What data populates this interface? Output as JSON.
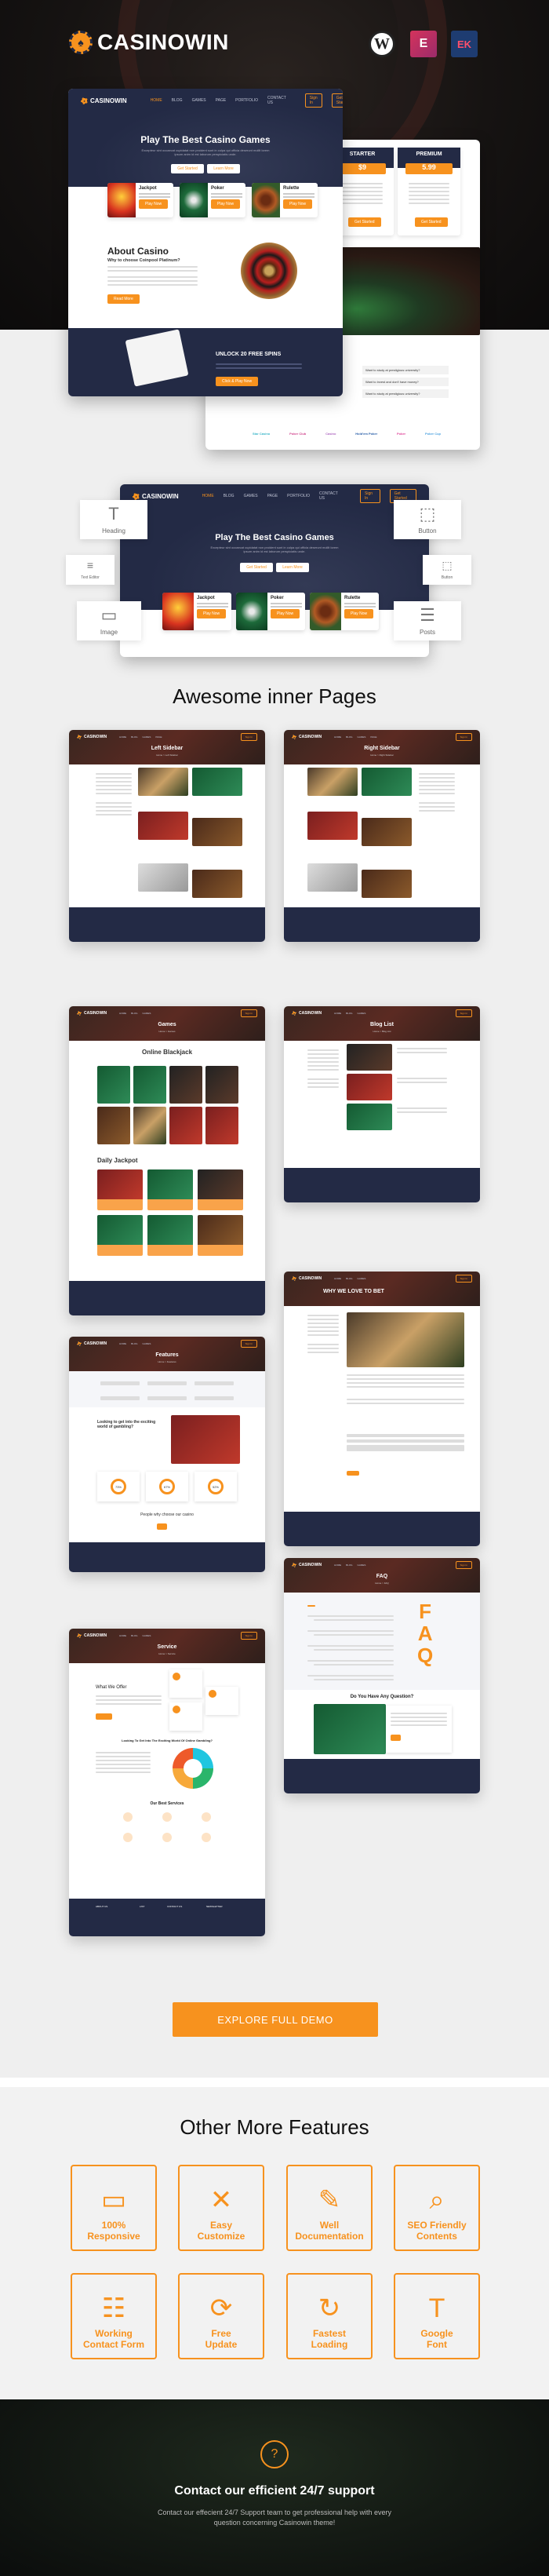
{
  "brand": {
    "name": "CASINOWIN",
    "accent": "#f7921e",
    "navy": "#232a45"
  },
  "platform_badges": [
    {
      "name": "wordpress-icon",
      "glyph": "W"
    },
    {
      "name": "elementor-icon",
      "glyph": "E"
    },
    {
      "name": "elementskit-icon",
      "glyph": "EK"
    }
  ],
  "mock_nav": {
    "items": [
      "HOME",
      "BLOG",
      "GAMES",
      "PAGE",
      "PORTFOLIO",
      "CONTACT US"
    ],
    "signin": "Sign In",
    "getstarted": "Get Started"
  },
  "home_mock": {
    "hero_title": "Play The Best Casino Games",
    "hero_text": "Excepteur sint occaecat cupidatat non proident sunt in culpa qui officia deserunt mollit lorem ipsum anim id est laborum perspiciatis unde.",
    "hero_btn1": "Get Started",
    "hero_btn2": "Learn More",
    "games": [
      {
        "title": "Jackpot",
        "text": "Find time to do a review for this casino slot",
        "btn": "Play Now"
      },
      {
        "title": "Poker",
        "text": "Find time to do a review for this casino slot",
        "btn": "Play Now"
      },
      {
        "title": "Rulette",
        "text": "Find time to do a review for this casino slot",
        "btn": "Play Now"
      }
    ],
    "about_title": "About Casino",
    "about_sub": "Why to choose Coinpool Platinum?",
    "about_btn": "Read More",
    "spins_title": "UNLOCK 20 FREE SPINS",
    "spins_btn": "Click & Play Now",
    "pricing": [
      {
        "name": "STARTER",
        "price": "$9"
      },
      {
        "name": "PREMIUM",
        "price": "5.99"
      }
    ],
    "pricing_btn": "Get Started",
    "faq": [
      "Want to study at prestigious university?",
      "Want to invest and don't have money?",
      "Want to study at prestigious university?"
    ],
    "partner_logos": [
      "Star Casino",
      "Poker Club",
      "Casino",
      "Hold'em Poker",
      "Poker",
      "Poker Cup"
    ]
  },
  "widgets": {
    "left": [
      {
        "icon": "T",
        "label": "Heading"
      },
      {
        "icon": "≡",
        "label": "Text Editor"
      },
      {
        "icon": "▭",
        "label": "Image"
      }
    ],
    "right": [
      {
        "icon": "⬚",
        "label": "Button"
      },
      {
        "icon": "⬚",
        "label": "Button"
      },
      {
        "icon": "☰",
        "label": "Posts"
      }
    ]
  },
  "inner_pages_heading": "Awesome inner Pages",
  "inner_pages": [
    {
      "title": "Left Sidebar",
      "crumb": "Home > Left Sidebar"
    },
    {
      "title": "Right Sidebar",
      "crumb": "Home > Right Sidebar"
    },
    {
      "title": "Games",
      "crumb": "Home > Games",
      "section1": "Online Blackjack",
      "section2": "Daily Jackpot"
    },
    {
      "title": "Blog List",
      "crumb": "Home > Blog List"
    },
    {
      "title": "Features",
      "crumb": "Home > Features",
      "section1": "Looking to get into the exciting world of gambling?",
      "stats": [
        "73%",
        "67%",
        "52%"
      ],
      "section2": "People why choose our casino"
    },
    {
      "title": "WHY WE LOVE TO BET",
      "crumb": ""
    },
    {
      "title": "FAQ",
      "crumb": "Home > FAQ",
      "section1": "Do You Have Any Question?"
    },
    {
      "title": "Service",
      "crumb": "Home > Service",
      "section1": "What We Offer",
      "section2": "Looking To Get Into The Exciting World Of Online Gambling?",
      "section3": "Our Best Services"
    }
  ],
  "footer_cols": [
    "ABOUT US",
    "LIST",
    "CONTACT US",
    "NEWSLETTER"
  ],
  "explore_btn": "EXPLORE FULL DEMO",
  "features_heading": "Other More Features",
  "features": [
    {
      "icon": "devices-icon",
      "label1": "100%",
      "label2": "Responsive"
    },
    {
      "icon": "tools-icon",
      "label1": "Easy",
      "label2": "Customize"
    },
    {
      "icon": "document-edit-icon",
      "label1": "Well",
      "label2": "Documentation"
    },
    {
      "icon": "seo-search-icon",
      "label1": "SEO Friendly",
      "label2": "Contents"
    },
    {
      "icon": "contact-form-icon",
      "label1": "Working",
      "label2": "Contact Form"
    },
    {
      "icon": "update-icon",
      "label1": "Free",
      "label2": "Update"
    },
    {
      "icon": "loading-icon",
      "label1": "Fastest",
      "label2": "Loading"
    },
    {
      "icon": "font-icon",
      "label1": "Google",
      "label2": "Font"
    }
  ],
  "support": {
    "title": "Contact our efficient 24/7 support",
    "text": "Contact our effecient 24/7 Support team to get professional help with every question concerning Casinowin theme!"
  }
}
